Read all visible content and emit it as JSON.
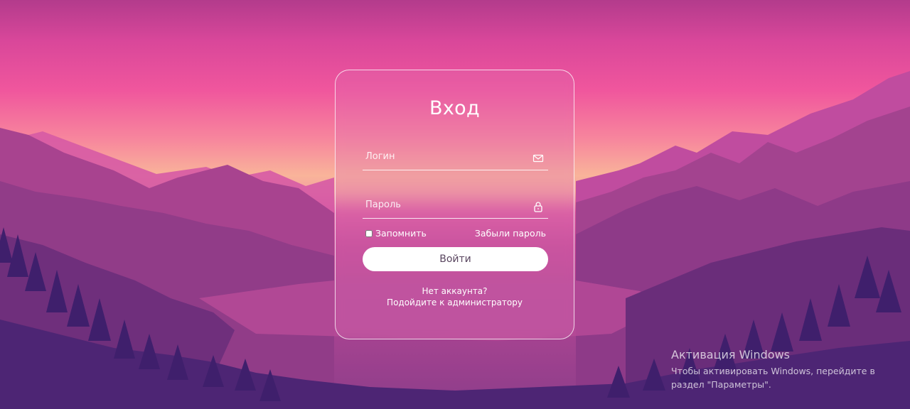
{
  "login_form": {
    "title": "Вход",
    "login_placeholder": "Логин",
    "login_icon": "envelope-icon",
    "password_placeholder": "Пароль",
    "password_icon": "lock-icon",
    "remember_label": "Запомнить",
    "remember_checked": false,
    "forgot_label": "Забыли пароль",
    "submit_label": "Войти",
    "no_account_line1": "Нет аккаунта?",
    "no_account_line2": "Подойдите к администратору"
  },
  "windows_activation": {
    "title": "Активация Windows",
    "text": "Чтобы активировать Windows, перейдите в раздел \"Параметры\"."
  },
  "colors": {
    "sky_top": "#b33b8c",
    "sky_mid": "#f0569d",
    "horizon": "#f9b49a",
    "button_bg": "#ffffff",
    "button_text": "#5a4660"
  }
}
